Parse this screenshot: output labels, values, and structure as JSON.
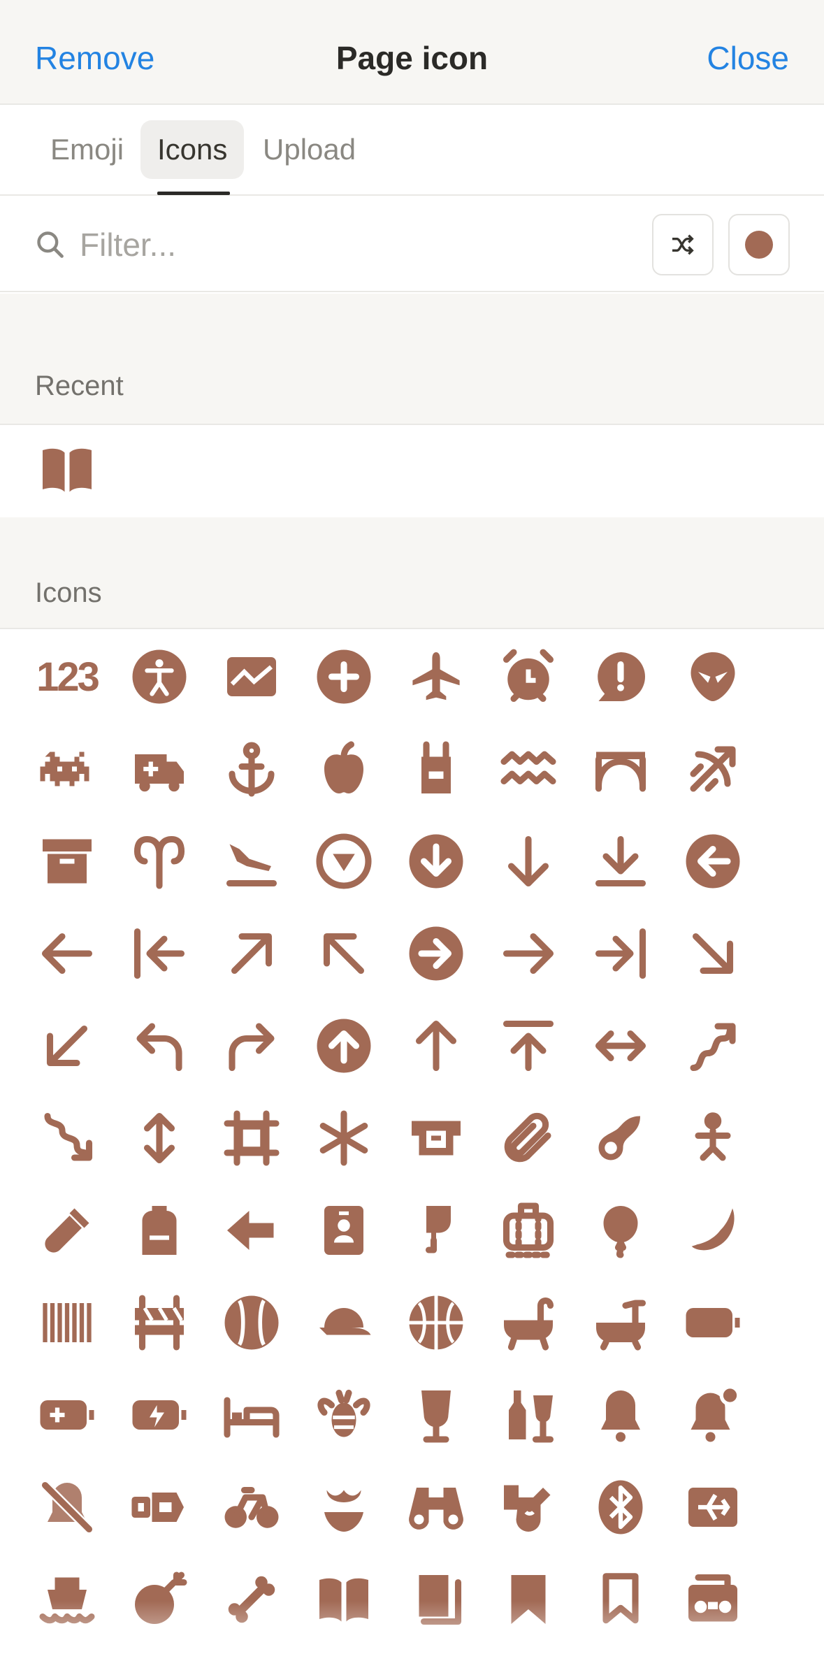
{
  "header": {
    "remove_label": "Remove",
    "title": "Page icon",
    "close_label": "Close"
  },
  "tabs": [
    {
      "label": "Emoji",
      "active": false
    },
    {
      "label": "Icons",
      "active": true
    },
    {
      "label": "Upload",
      "active": false
    }
  ],
  "search": {
    "placeholder": "Filter..."
  },
  "icon_color": "#a26a55",
  "recent": {
    "label": "Recent",
    "icons": [
      "book-open-icon"
    ]
  },
  "icons": {
    "label": "Icons",
    "number_glyph_text": "123",
    "items": [
      "123-icon",
      "accessibility-icon",
      "chart-area-icon",
      "add-circle-icon",
      "airplane-icon",
      "alarm-clock-icon",
      "alert-bubble-icon",
      "alien-icon",
      "space-invader-icon",
      "ambulance-icon",
      "anchor-icon",
      "apple-icon",
      "apron-icon",
      "aquarius-icon",
      "bridge-arch-icon",
      "archery-icon",
      "archive-box-icon",
      "aries-icon",
      "airplane-landing-icon",
      "arrow-down-circle-outline-icon",
      "arrow-down-circle-icon",
      "arrow-down-icon",
      "arrow-down-line-icon",
      "arrow-left-circle-icon",
      "arrow-left-icon",
      "arrow-left-line-icon",
      "arrow-up-right-icon",
      "arrow-up-left-icon",
      "arrow-right-circle-icon",
      "arrow-right-icon",
      "arrow-right-line-icon",
      "arrow-down-right-icon",
      "arrow-down-left-icon",
      "arrow-turn-left-icon",
      "arrow-turn-right-icon",
      "arrow-up-circle-icon",
      "arrow-up-icon",
      "arrow-up-line-icon",
      "arrow-left-right-icon",
      "arrow-squiggle-up-icon",
      "arrow-squiggle-down-icon",
      "arrow-up-down-icon",
      "artboard-icon",
      "asterisk-icon",
      "atm-icon",
      "attachment-icon",
      "avocado-icon",
      "baby-icon",
      "baby-bottle-icon",
      "backpack-icon",
      "back-arrow-icon",
      "badge-icon",
      "bag-tea-icon",
      "baggage-icon",
      "balloon-icon",
      "banana-icon",
      "barcode-icon",
      "barricade-icon",
      "baseball-icon",
      "baseball-cap-icon",
      "basketball-icon",
      "bathtub-icon",
      "bath-shower-icon",
      "battery-icon",
      "battery-charging-icon",
      "battery-charge-icon",
      "bed-icon",
      "bee-icon",
      "beer-glass-icon",
      "beer-bottle-icon",
      "bell-icon",
      "bell-notification-icon",
      "bell-off-icon",
      "bench-plug-icon",
      "bicycle-icon",
      "bikini-icon",
      "binoculars-icon",
      "biometric-icon",
      "bluetooth-icon",
      "board-airplane-icon",
      "boat-icon",
      "bomb-icon",
      "bone-icon",
      "book-open-icon",
      "book-closed-icon",
      "bookmark-icon",
      "bookmark-outline-icon",
      "boombox-icon"
    ]
  }
}
